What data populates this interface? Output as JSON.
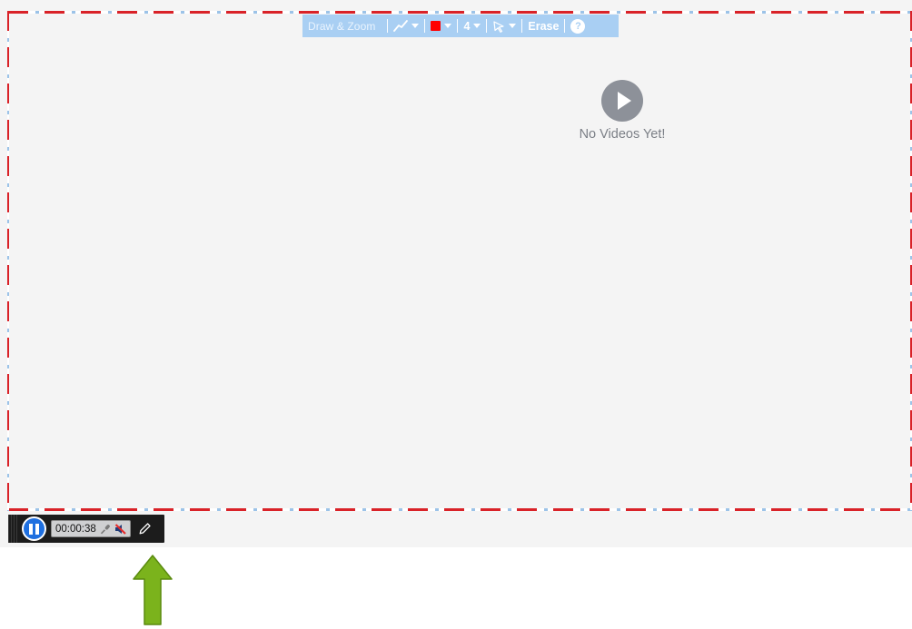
{
  "toolbar": {
    "title": "Draw & Zoom",
    "tool_icon": "line-draw-icon",
    "color": "#ff0000",
    "size": "4",
    "pointer_icon": "pointer-icon",
    "erase_label": "Erase",
    "help_label": "?"
  },
  "empty_state": {
    "icon": "play-icon",
    "message": "No Videos Yet!"
  },
  "recorder": {
    "timer": "00:00:38",
    "state_icon": "pause-icon",
    "mic_icon": "microphone-icon",
    "speaker_icon": "speaker-muted-icon",
    "draw_icon": "pencil-icon"
  },
  "colors": {
    "toolbar_bg": "#a9cff3",
    "border_dash": "#d92228",
    "pause_button": "#1e6fe0",
    "arrow": "#7bb31c"
  }
}
